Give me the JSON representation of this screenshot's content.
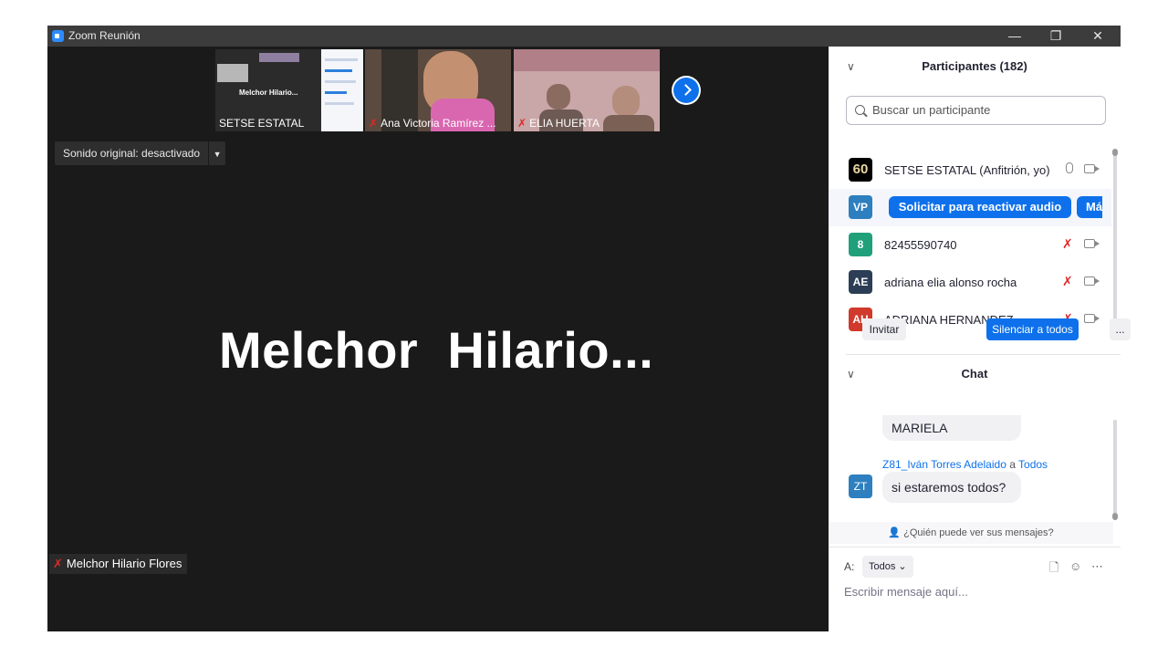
{
  "window": {
    "title": "Zoom Reunión",
    "controls": {
      "minimize": "—",
      "restore": "❐",
      "close": "✕"
    }
  },
  "thumbnails": [
    {
      "name": "SETSE ESTATAL",
      "muted": false,
      "preview_text": "Melchor Hilario..."
    },
    {
      "name": "Ana Victoria Ramírez ...",
      "muted": true
    },
    {
      "name": "ELIA HUERTA",
      "muted": true
    }
  ],
  "sound": {
    "label": "Sonido original: desactivado"
  },
  "active_speaker": {
    "display_name": "Melchor  Hilario...",
    "name_tag": "Melchor Hilario Flores",
    "muted": true
  },
  "participants": {
    "header": "Participantes (182)",
    "search_placeholder": "Buscar un participante",
    "list": [
      {
        "initials": "60",
        "name": "SETSE ESTATAL (Anfitrión, yo)",
        "color": "#000000",
        "muted": false
      },
      {
        "initials": "VP",
        "name": "",
        "color": "#2d7fbf",
        "actions": [
          "Solicitar para reactivar audio",
          "Más"
        ]
      },
      {
        "initials": "8",
        "name": "82455590740",
        "color": "#20a07a",
        "muted": true
      },
      {
        "initials": "AE",
        "name": "adriana elia alonso rocha",
        "color": "#2c3e55",
        "muted": true
      },
      {
        "initials": "AH",
        "name": "ADRIANA HERNANDEZ",
        "color": "#d0392b",
        "muted": true
      }
    ],
    "buttons": {
      "invite": "Invitar",
      "mute_all": "Silenciar a todos",
      "more": "..."
    }
  },
  "chat": {
    "header": "Chat",
    "messages": [
      {
        "text": "MARIELA"
      },
      {
        "sender": "Z81_Iván Torres Adelaido",
        "to_word": "a",
        "recipient": "Todos",
        "initials": "ZT",
        "text": "si estaremos todos?"
      }
    ],
    "who_can_see": "¿Quién puede ver sus mensajes?",
    "to_label": "A:",
    "to_value": "Todos",
    "input_placeholder": "Escribir mensaje aquí..."
  },
  "colors": {
    "accent": "#0e71eb",
    "mute_red": "#e02828",
    "stage_bg": "#1a1a1a"
  }
}
